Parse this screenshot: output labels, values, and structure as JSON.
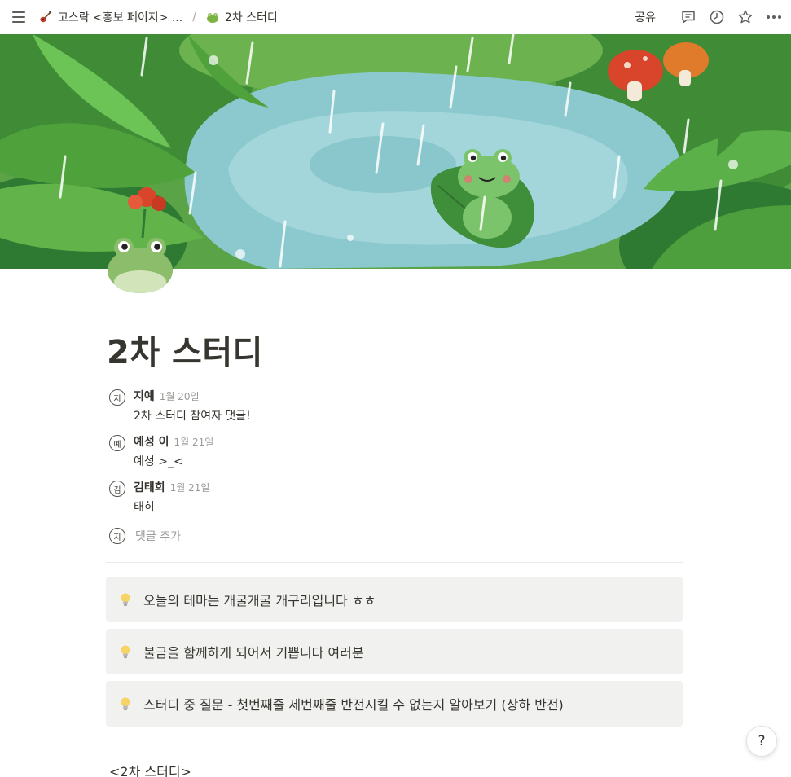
{
  "topbar": {
    "breadcrumbs": [
      {
        "label": "고스락 <홍보 페이지> ...",
        "icon": "guitar-icon"
      },
      {
        "label": "2차 스터디",
        "icon": "frog-icon"
      }
    ],
    "separator": "/",
    "share_label": "공유",
    "actions": [
      "comment-icon",
      "history-icon",
      "star-icon",
      "more-icon"
    ]
  },
  "page": {
    "title": "2차 스터디",
    "cover": "rain-pond-frog-illustration",
    "icon": "frog-icon"
  },
  "comments": [
    {
      "avatar": "지",
      "author": "지예",
      "date": "1월 20일",
      "text": "2차 스터디 참여자 댓글!"
    },
    {
      "avatar": "예",
      "author": "예성 이",
      "date": "1월 21일",
      "text": "예성 >_<"
    },
    {
      "avatar": "김",
      "author": "김태희",
      "date": "1월 21일",
      "text": "태히"
    }
  ],
  "add_comment": {
    "avatar": "지",
    "placeholder": "댓글 추가"
  },
  "callouts": [
    {
      "icon": "lightbulb-icon",
      "text": "오늘의 테마는 개굴개굴 개구리입니다 ㅎㅎ"
    },
    {
      "icon": "lightbulb-icon",
      "text": "불금을 함께하게 되어서 기쁩니다 여러분"
    },
    {
      "icon": "lightbulb-icon",
      "text": "스터디 중 질문 - 첫번째줄 세번째줄 반전시킬 수 없는지 알아보기 (상하 반전)"
    }
  ],
  "section_title": "<2차 스터디>",
  "help_label": "?",
  "colors": {
    "text": "#37352f",
    "muted": "#9b9a97",
    "callout_bg": "#f1f1ef",
    "cover_water": "#8cc9cf",
    "cover_leaf": "#4c9a3c"
  }
}
